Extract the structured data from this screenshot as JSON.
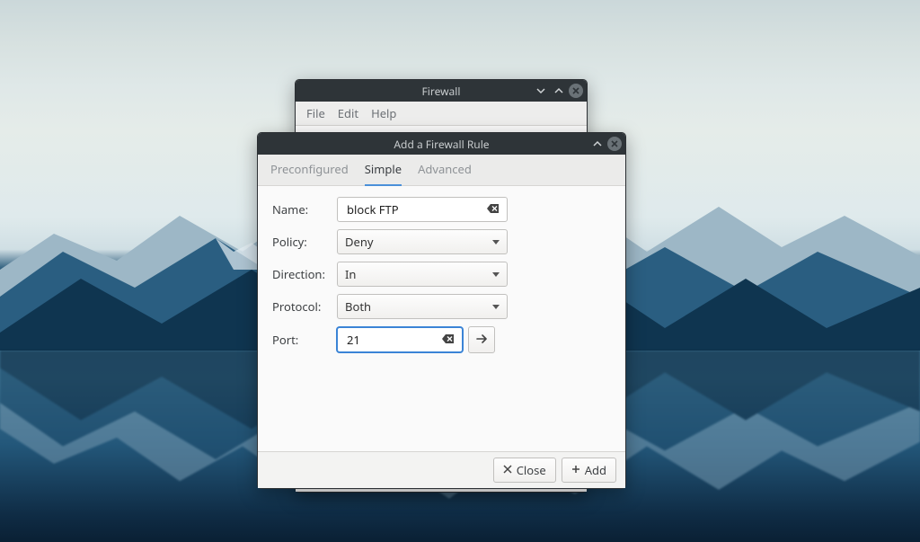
{
  "back_window": {
    "title": "Firewall",
    "menu": [
      "File",
      "Edit",
      "Help"
    ]
  },
  "dialog": {
    "title": "Add a Firewall Rule",
    "tabs": {
      "preconfigured": "Preconfigured",
      "simple": "Simple",
      "advanced": "Advanced"
    },
    "labels": {
      "name": "Name:",
      "policy": "Policy:",
      "direction": "Direction:",
      "protocol": "Protocol:",
      "port": "Port:"
    },
    "values": {
      "name": "block FTP",
      "policy": "Deny",
      "direction": "In",
      "protocol": "Both",
      "port": "21"
    },
    "footer": {
      "close": "Close",
      "add": "Add"
    }
  }
}
